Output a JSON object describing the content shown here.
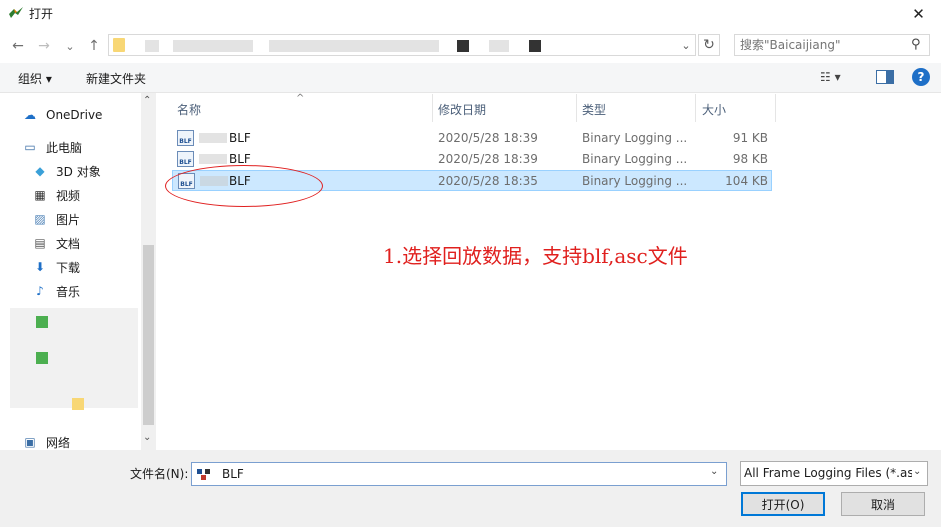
{
  "window": {
    "title": "打开",
    "close_glyph": "✕"
  },
  "nav": {
    "back_glyph": "←",
    "forward_glyph": "→",
    "recent_glyph": "⌄",
    "up_glyph": "↑",
    "dropdown_glyph": "⌄",
    "refresh_glyph": "↻",
    "search_placeholder": "搜索\"Baicaijiang\"",
    "search_glyph": "⚲"
  },
  "toolbar": {
    "organize": "组织 ▾",
    "new_folder": "新建文件夹",
    "view": "☷ ▾",
    "help": "?"
  },
  "sidebar": {
    "items": [
      {
        "label": "OneDrive",
        "icon": "cloud-icon",
        "glyph": "☁",
        "color": "#1e6fc7"
      },
      {
        "label": "此电脑",
        "icon": "computer-icon",
        "glyph": "▭",
        "color": "#3b6ea5"
      },
      {
        "label": "3D 对象",
        "icon": "cube-icon",
        "glyph": "◆",
        "color": "#3aa0d8"
      },
      {
        "label": "视频",
        "icon": "video-icon",
        "glyph": "▦",
        "color": "#333333"
      },
      {
        "label": "图片",
        "icon": "picture-icon",
        "glyph": "▨",
        "color": "#4a7fb5"
      },
      {
        "label": "文档",
        "icon": "document-icon",
        "glyph": "▤",
        "color": "#555555"
      },
      {
        "label": "下载",
        "icon": "download-icon",
        "glyph": "⬇",
        "color": "#1e6fc7"
      },
      {
        "label": "音乐",
        "icon": "music-icon",
        "glyph": "♪",
        "color": "#1e6fc7"
      },
      {
        "label": "网络",
        "icon": "network-icon",
        "glyph": "▣",
        "color": "#3b6ea5"
      }
    ],
    "scroll_up": "⌃",
    "scroll_down": "⌄"
  },
  "filelist": {
    "columns": [
      "名称",
      "修改日期",
      "类型",
      "大小"
    ],
    "sort_glyph": "^",
    "rows": [
      {
        "name": "BLF",
        "date": "2020/5/28 18:39",
        "type": "Binary Logging ...",
        "size": "91 KB"
      },
      {
        "name": "BLF",
        "date": "2020/5/28 18:39",
        "type": "Binary Logging ...",
        "size": "98 KB"
      },
      {
        "name": "BLF",
        "date": "2020/5/28 18:35",
        "type": "Binary Logging ...",
        "size": "104 KB"
      }
    ],
    "icon_text": "BLF"
  },
  "annotation": "1.选择回放数据，支持blf,asc文件",
  "bottom": {
    "filename_label": "文件名(N):",
    "filename_value": "BLF",
    "filter": "All Frame Logging Files (*.as",
    "dropdown_glyph": "⌄",
    "open": "打开(O)",
    "cancel": "取消"
  }
}
